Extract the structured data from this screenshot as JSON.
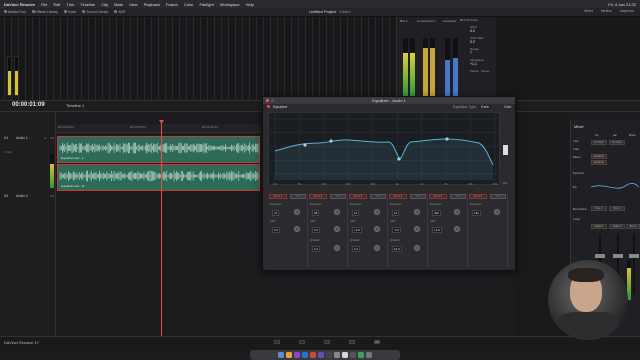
{
  "menubar": {
    "app": "DaVinci Resolve",
    "items": [
      "File",
      "Edit",
      "Trim",
      "Timeline",
      "Clip",
      "Mark",
      "View",
      "Playback",
      "Fusion",
      "Color",
      "Fairlight",
      "Workspace",
      "Help"
    ],
    "clock": "Fri, 8 Jan 21:32"
  },
  "toolbar": {
    "items": [
      "Media Pool",
      "Effects Library",
      "Index",
      "Sound Library",
      "ADR"
    ],
    "project": "Untitled Project",
    "project_state": "Edited",
    "right": [
      "Mixer",
      "Meters",
      "Inspector"
    ]
  },
  "monitor": {
    "bus_label": "Bus 1",
    "control_room": "Control Room",
    "loudness": "Loudness",
    "standard": "BS.1770-1 (LU)",
    "short": {
      "label": "Short",
      "value": "0.2"
    },
    "short_max": {
      "label": "Short Max",
      "value": "0.2"
    },
    "range": {
      "label": "Range",
      "value": "7"
    },
    "integrated": {
      "label": "Integrated",
      "value": "+1.1"
    },
    "pause": "Pause",
    "reset": "Reset"
  },
  "timeline": {
    "timecode": "00:00:01:09",
    "name": "Timeline 1",
    "ruler": [
      "00:00:00:00",
      "00:00:05:00",
      "00:00:10:00"
    ],
    "tracks": [
      {
        "id": "A1",
        "name": "Audio 1",
        "fx": "fx",
        "meta": "2.0",
        "clips": "1 Clip"
      },
      {
        "id": "A2",
        "name": "Audio 2",
        "fx": "",
        "meta": "2.0",
        "clips": ""
      }
    ],
    "clips": [
      {
        "label": "Equalizer.wav - L"
      },
      {
        "label": "Equalizer.wav - R"
      }
    ]
  },
  "eq": {
    "title": "Equalizer - Audio 1",
    "plugin": "Equalizer",
    "type_label": "Equalizer Type",
    "type_value": "Earth",
    "gain_label": "Gain",
    "gain_value": "0.0",
    "freq_ticks": [
      "20",
      "50",
      "100",
      "200",
      "500",
      "1k",
      "2k",
      "5k",
      "10k",
      "20k"
    ],
    "db_ticks": [
      "+20",
      "+10",
      "0",
      "-10",
      "-20"
    ],
    "bands": [
      {
        "label": "Band 1",
        "freq": "47",
        "gain": "0.0",
        "q": "",
        "freq_label": "Frequency",
        "gain_label": "Gain",
        "q_label": ""
      },
      {
        "label": "Band 2",
        "freq": "58",
        "gain": "0.0",
        "q": "3.4",
        "freq_label": "Frequency",
        "gain_label": "Gain",
        "q_label": "Q Factor"
      },
      {
        "label": "Band 3",
        "freq": "1k",
        "gain": "+3.6",
        "q": "3.4",
        "freq_label": "Frequency",
        "gain_label": "Gain",
        "q_label": "Q Factor"
      },
      {
        "label": "Band 4",
        "freq": "1k",
        "gain": "-6.6",
        "q": "10.0",
        "freq_label": "Frequency",
        "gain_label": "Gain",
        "q_label": "Q Factor"
      },
      {
        "label": "Band 5",
        "freq": "4k6",
        "gain": "+4.0",
        "q": "",
        "freq_label": "Frequency",
        "gain_label": "Gain",
        "q_label": ""
      },
      {
        "label": "Band 6",
        "freq": "13k",
        "gain": "",
        "q": "",
        "freq_label": "Frequency",
        "gain_label": "",
        "q_label": ""
      }
    ]
  },
  "mixer": {
    "title": "Mixer",
    "channels": [
      "A1",
      "A2",
      "Bus1"
    ],
    "rows": [
      "Input",
      "Order",
      "Effects",
      "Dynamics",
      "EQ",
      "Bus Outputs",
      "Group"
    ],
    "inputs": [
      "No Input",
      "No Input"
    ],
    "effects": [
      "Equalizer",
      "Equalizer"
    ],
    "bus_values": [
      "Bus 1",
      "Bus 1"
    ],
    "names": [
      "Audio 1",
      "Audio 2",
      "Bus 1"
    ],
    "levels": [
      "0.0",
      "0.0",
      "0.0"
    ]
  },
  "status": {
    "app_name": "DaVinci Resolve 17"
  },
  "colors": {
    "accent": "#d7c234",
    "clip": "#2d6b57",
    "clip_border": "#c23c3c",
    "playhead": "#e0533a",
    "eq_curve": "#5fb0d8"
  }
}
